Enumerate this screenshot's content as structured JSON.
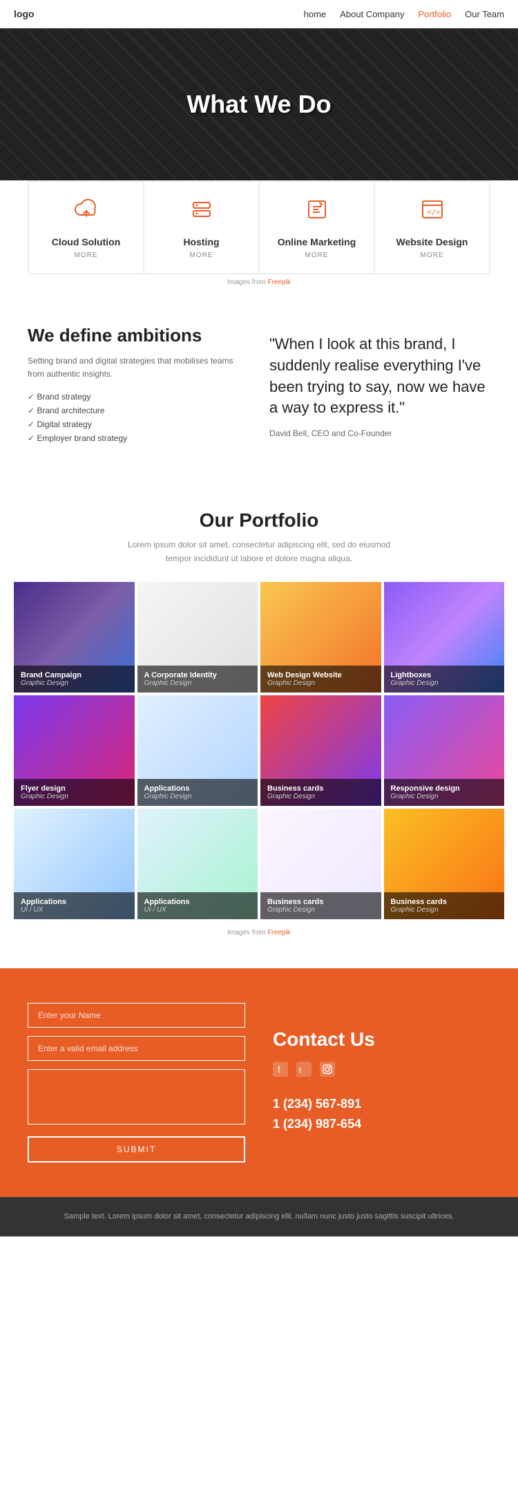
{
  "nav": {
    "logo": "logo",
    "links": [
      {
        "label": "home",
        "active": false
      },
      {
        "label": "About Company",
        "active": false
      },
      {
        "label": "Portfolio",
        "active": true
      },
      {
        "label": "Our Team",
        "active": false
      }
    ]
  },
  "hero": {
    "title": "What We Do"
  },
  "services": [
    {
      "icon": "☁",
      "title": "Cloud Solution",
      "more": "MORE"
    },
    {
      "icon": "≡",
      "title": "Hosting",
      "more": "MORE"
    },
    {
      "icon": "☑",
      "title": "Online Marketing",
      "more": "MORE"
    },
    {
      "icon": "</>",
      "title": "Website Design",
      "more": "MORE"
    }
  ],
  "about": {
    "heading": "We define ambitions",
    "description": "Setting brand and digital strategies that mobilises teams from authentic insights.",
    "list": [
      "Brand strategy",
      "Brand architecture",
      "Digital strategy",
      "Employer brand strategy"
    ],
    "quote": "\"When I look at this brand, I suddenly realise everything I've been trying to say, now we have a way to express it.\"",
    "attribution": "David Bell, CEO and Co-Founder"
  },
  "portfolio": {
    "title": "Our Portfolio",
    "subtitle": "Lorem ipsum dolor sit amet, consectetur adipiscing elit, sed do eiusmod tempor incididunt ut labore et dolore magna aliqua.",
    "items": [
      {
        "title": "Brand Campaign",
        "cat": "Graphic Design",
        "bg": "pi-1"
      },
      {
        "title": "A Corporate Identity",
        "cat": "Graphic Design",
        "bg": "pi-2"
      },
      {
        "title": "Web Design Website",
        "cat": "Graphic Design",
        "bg": "pi-3"
      },
      {
        "title": "Lightboxes",
        "cat": "Graphic Design",
        "bg": "pi-4"
      },
      {
        "title": "Flyer design",
        "cat": "Graphic Design",
        "bg": "pi-5"
      },
      {
        "title": "Applications",
        "cat": "Graphic Design",
        "bg": "pi-6"
      },
      {
        "title": "Business cards",
        "cat": "Graphic Design",
        "bg": "pi-7"
      },
      {
        "title": "Responsive design",
        "cat": "Graphic Design",
        "bg": "pi-8"
      },
      {
        "title": "Applications",
        "cat": "UI / UX",
        "bg": "pi-9"
      },
      {
        "title": "Applications",
        "cat": "UI / UX",
        "bg": "pi-10"
      },
      {
        "title": "Business cards",
        "cat": "Graphic Design",
        "bg": "pi-11"
      },
      {
        "title": "Business cards",
        "cat": "Graphic Design",
        "bg": "pi-12"
      }
    ],
    "freepik": "Images from Freepik"
  },
  "contact": {
    "title": "Contact Us",
    "form": {
      "name_placeholder": "Enter your Name",
      "email_placeholder": "Enter a valid email address",
      "message_placeholder": "",
      "submit_label": "SUBMIT"
    },
    "phones": [
      "1 (234) 567-891",
      "1 (234) 987-654"
    ],
    "social": [
      "f",
      "t",
      "i"
    ]
  },
  "footer": {
    "text": "Sample text. Lorem ipsum dolor sit amet, consectetur adipiscing elit.\nnullam nunc justo justo sagittis suscipit ultrices."
  },
  "freepik_note": "Images from Freepik"
}
